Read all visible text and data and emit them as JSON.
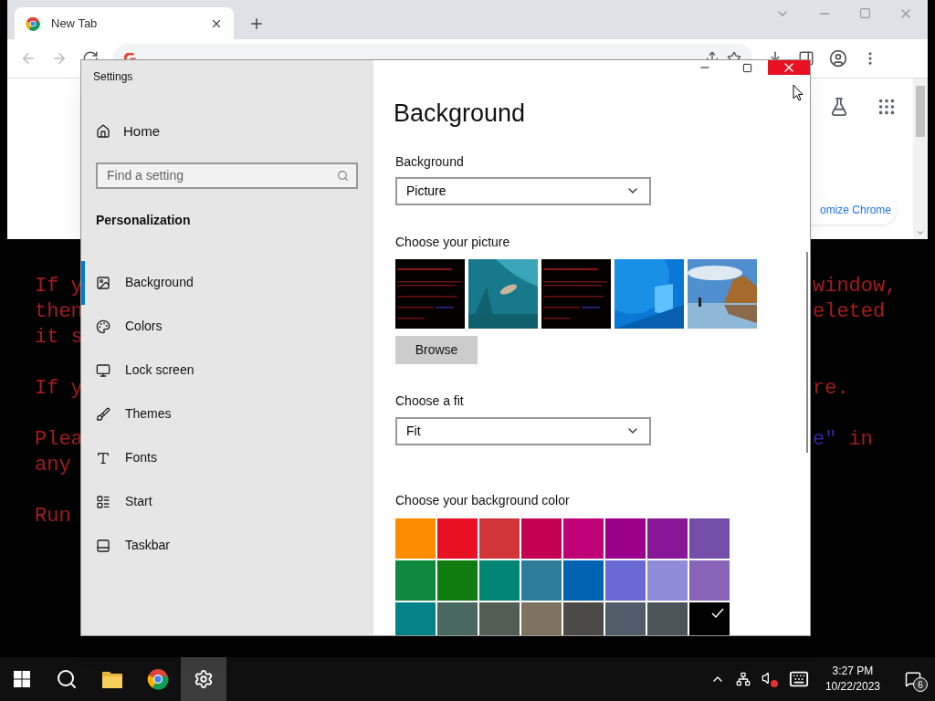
{
  "chrome": {
    "tab": {
      "title": "New Tab",
      "selected": true
    },
    "customize_button": "omize Chrome"
  },
  "wallpaper": {
    "paragraphs": [
      {
        "lines": [
          {
            "left": "If y",
            "right": [
              {
                "text": "window,",
                "color": "#a51c1c"
              }
            ]
          },
          {
            "left": "then",
            "right": [
              {
                "text": "eleted",
                "color": "#a51c1c"
              }
            ]
          },
          {
            "left": "it s"
          }
        ]
      },
      {
        "lines": [
          {
            "left": "If y",
            "right": [
              {
                "text": "re.",
                "color": "#a51c1c"
              }
            ]
          }
        ]
      },
      {
        "lines": [
          {
            "left": "Plea",
            "right": [
              {
                "text": "e\"",
                "color": "#2c2ca8"
              },
              {
                "text": "in",
                "color": "#a51c1c"
              }
            ]
          },
          {
            "left": "any"
          }
        ]
      },
      {
        "lines": [
          {
            "left": "Run"
          }
        ]
      }
    ]
  },
  "settings": {
    "title": "Settings",
    "close_hovered": true,
    "sidebar": {
      "home": "Home",
      "search": {
        "placeholder": "Find a setting"
      },
      "section": "Personalization",
      "items": [
        {
          "label": "Background",
          "selected": true
        },
        {
          "label": "Colors",
          "selected": false
        },
        {
          "label": "Lock screen",
          "selected": false
        },
        {
          "label": "Themes",
          "selected": false
        },
        {
          "label": "Fonts",
          "selected": false
        },
        {
          "label": "Start",
          "selected": false
        },
        {
          "label": "Taskbar",
          "selected": false
        }
      ]
    },
    "page": {
      "title": "Background",
      "background_label": "Background",
      "background_value": "Picture",
      "picture_label": "Choose your picture",
      "browse": "Browse",
      "fit_label": "Choose a fit",
      "fit_value": "Fit",
      "color_label": "Choose your background color",
      "colors": [
        {
          "color": "#ff8c00",
          "selected": false
        },
        {
          "color": "#e81123",
          "selected": false
        },
        {
          "color": "#d13438",
          "selected": false
        },
        {
          "color": "#c30052",
          "selected": false
        },
        {
          "color": "#bf0077",
          "selected": false
        },
        {
          "color": "#9a0089",
          "selected": false
        },
        {
          "color": "#881798",
          "selected": false
        },
        {
          "color": "#744da9",
          "selected": false
        },
        {
          "color": "#10893e",
          "selected": false
        },
        {
          "color": "#107c10",
          "selected": false
        },
        {
          "color": "#018574",
          "selected": false
        },
        {
          "color": "#2d7d9a",
          "selected": false
        },
        {
          "color": "#0063b1",
          "selected": false
        },
        {
          "color": "#6b69d6",
          "selected": false
        },
        {
          "color": "#8e8cd8",
          "selected": false
        },
        {
          "color": "#8764b8",
          "selected": false
        },
        {
          "color": "#038387",
          "selected": false
        },
        {
          "color": "#486860",
          "selected": false
        },
        {
          "color": "#525e54",
          "selected": false
        },
        {
          "color": "#7e735f",
          "selected": false
        },
        {
          "color": "#4c4a48",
          "selected": false
        },
        {
          "color": "#515c6b",
          "selected": false
        },
        {
          "color": "#4a5459",
          "selected": false
        },
        {
          "color": "#000000",
          "selected": true
        }
      ]
    }
  },
  "taskbar": {
    "apps": [
      {
        "selected": false
      },
      {
        "selected": false
      },
      {
        "selected": false
      },
      {
        "selected": true
      }
    ],
    "volume_muted": true,
    "time": "3:27 PM",
    "date": "10/22/2023",
    "notifications": "6"
  }
}
